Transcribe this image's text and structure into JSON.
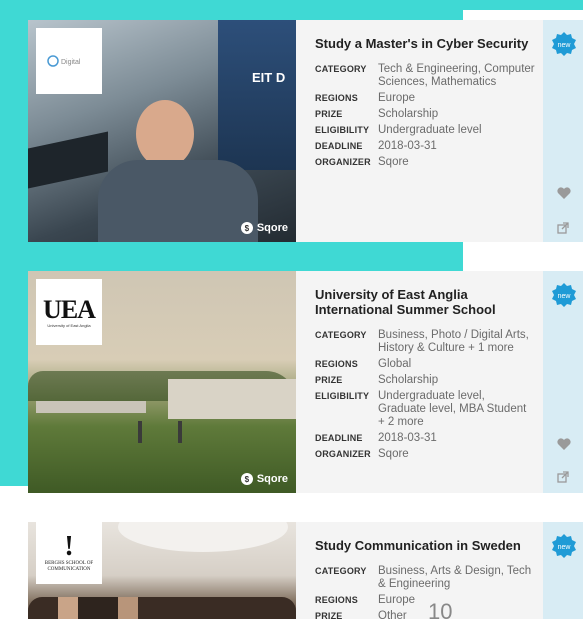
{
  "cards": [
    {
      "title": "Study a Master's in Cyber Security",
      "logo_text": "Digital",
      "fields": [
        {
          "label": "CATEGORY",
          "value": "Tech & Engineering, Computer Sciences, Mathematics"
        },
        {
          "label": "REGIONS",
          "value": "Europe"
        },
        {
          "label": "PRIZE",
          "value": "Scholarship"
        },
        {
          "label": "ELIGIBILITY",
          "value": "Undergraduate level"
        },
        {
          "label": "DEADLINE",
          "value": "2018-03-31"
        },
        {
          "label": "ORGANIZER",
          "value": "Sqore"
        }
      ],
      "badge": "new",
      "brand": "Sqore",
      "photo_sign": "EIT D"
    },
    {
      "title": "University of East Anglia International Summer School",
      "logo_text": "UEA",
      "logo_subtext": "University of East Anglia",
      "fields": [
        {
          "label": "CATEGORY",
          "value": "Business, Photo / Digital Arts, History & Culture + 1 more"
        },
        {
          "label": "REGIONS",
          "value": "Global"
        },
        {
          "label": "PRIZE",
          "value": "Scholarship"
        },
        {
          "label": "ELIGIBILITY",
          "value": "Undergraduate level, Graduate level, MBA Student + 2 more"
        },
        {
          "label": "DEADLINE",
          "value": "2018-03-31"
        },
        {
          "label": "ORGANIZER",
          "value": "Sqore"
        }
      ],
      "badge": "new",
      "brand": "Sqore"
    },
    {
      "title": "Study Communication in Sweden",
      "logo_text": "BERGHS SCHOOL OF COMMUNICATION",
      "fields": [
        {
          "label": "CATEGORY",
          "value": "Business, Arts & Design, Tech & Engineering"
        },
        {
          "label": "REGIONS",
          "value": "Europe"
        },
        {
          "label": "PRIZE",
          "value": "Other"
        }
      ],
      "badge": "new"
    }
  ],
  "page_number": "10",
  "colors": {
    "accent": "#3fd9d4",
    "badge": "#1f9bd6",
    "side": "#d8ecf4"
  }
}
